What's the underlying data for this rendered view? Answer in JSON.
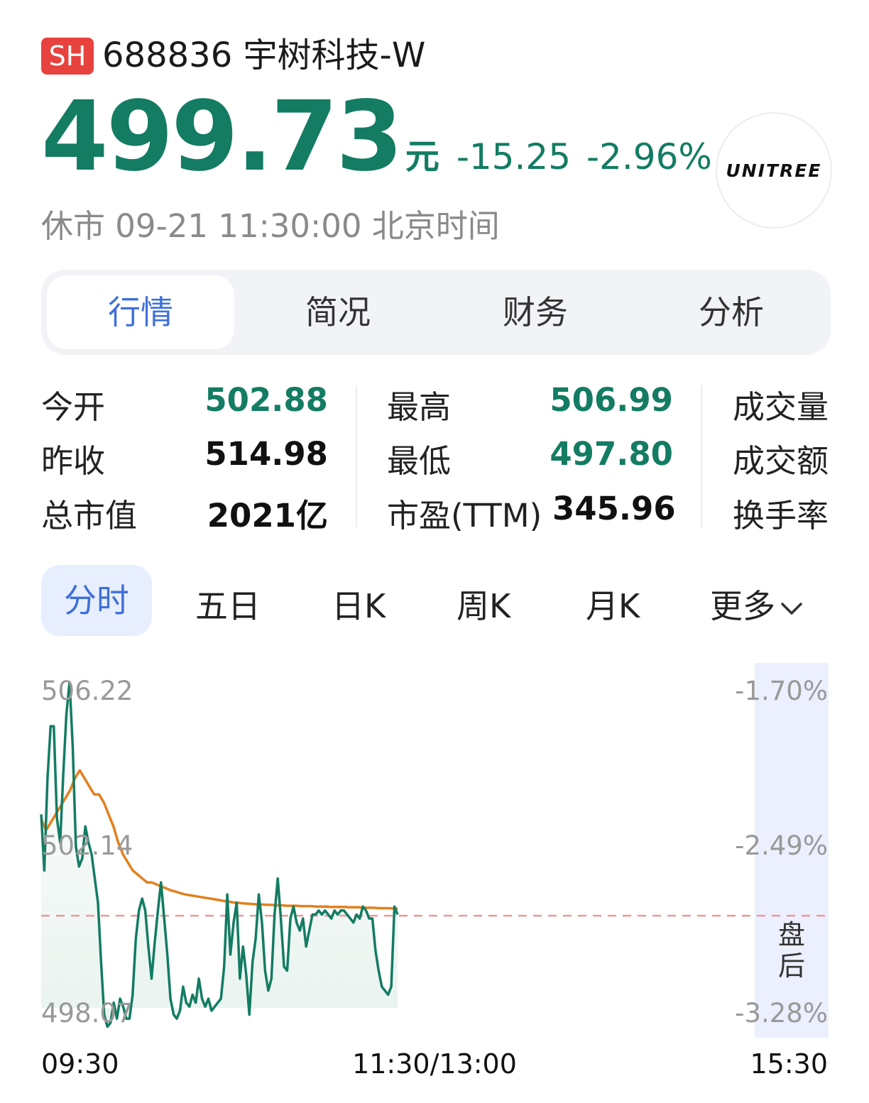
{
  "header": {
    "exchange": "SH",
    "code_name": "688836 宇树科技-W",
    "price": "499.73",
    "price_unit": "元",
    "change": "-15.25",
    "change_pct": "-2.96%",
    "status": "休市 09-21 11:30:00 北京时间",
    "logo_text": "UNITREE"
  },
  "main_tabs": [
    {
      "label": "行情",
      "active": true
    },
    {
      "label": "简况",
      "active": false
    },
    {
      "label": "财务",
      "active": false
    },
    {
      "label": "分析",
      "active": false
    }
  ],
  "quote": {
    "open_label": "今开",
    "open": "502.88",
    "prev_close_label": "昨收",
    "prev_close": "514.98",
    "mkt_cap_label": "总市值",
    "mkt_cap": "2021亿",
    "high_label": "最高",
    "high": "506.99",
    "low_label": "最低",
    "low": "497.80",
    "pe_label": "市盈(TTM)",
    "pe": "345.96",
    "volume_label": "成交量",
    "amount_label": "成交额",
    "turnover_label": "换手率"
  },
  "chart_tabs": [
    {
      "label": "分时",
      "active": true
    },
    {
      "label": "五日",
      "active": false
    },
    {
      "label": "日K",
      "active": false
    },
    {
      "label": "周K",
      "active": false
    },
    {
      "label": "月K",
      "active": false
    },
    {
      "label": "更多",
      "active": false
    }
  ],
  "chart_data": {
    "type": "line",
    "x_time_labels": [
      "09:30",
      "11:30/13:00",
      "15:30"
    ],
    "y_ticks": [
      "506.22",
      "502.14",
      "498.07"
    ],
    "y_pct_ticks": [
      "-1.70%",
      "-2.49%",
      "-3.28%"
    ],
    "ylim": [
      498.07,
      506.22
    ],
    "after_hours_label": "盘后",
    "reference_level": 500.37,
    "colors": {
      "price": "#137c62",
      "avg": "#e2801e",
      "ref": "#e89a9a",
      "fill": "#e9f3ef",
      "after_hours": "#eceffd"
    },
    "series": [
      {
        "values": [
          502.9,
          501.5,
          503.8,
          505.1,
          505.1,
          502.8,
          502.2,
          503.9,
          505.4,
          506.2,
          504.6,
          502.1,
          501.6,
          501.8,
          502.6,
          502.2,
          501.9,
          501.3,
          500.7,
          499.2,
          497.9,
          497.6,
          497.7,
          498.2,
          497.8,
          498.3,
          498.1,
          497.8,
          497.8,
          498.4,
          499.8,
          500.5,
          500.8,
          500.5,
          499.6,
          498.8,
          499.7,
          500.5,
          501.2,
          500.3,
          499.4,
          498.3,
          497.9,
          497.8,
          498.0,
          498.6,
          498.2,
          498.1,
          498.4,
          498.2,
          498.8,
          498.3,
          498.1,
          498.3,
          498.0,
          498.1,
          498.2,
          498.3,
          499.1,
          500.9,
          499.4,
          500.2,
          500.7,
          498.8,
          499.6,
          498.9,
          497.9,
          499.2,
          499.8,
          500.9,
          500.2,
          499.0,
          498.5,
          498.8,
          500.4,
          501.3,
          500.3,
          499.1,
          499.0,
          500.3,
          500.6,
          500.2,
          500.0,
          500.3,
          499.6,
          500.0,
          500.4,
          500.4,
          500.5,
          500.4,
          500.5,
          500.4,
          500.3,
          500.5,
          500.4,
          500.5,
          500.5,
          500.4,
          500.3,
          500.2,
          500.4,
          500.3,
          500.6,
          500.5,
          500.3,
          500.3,
          499.5,
          499.0,
          498.6,
          498.5,
          498.4,
          498.6,
          500.6,
          500.4
        ]
      },
      {
        "values": [
          502.8,
          502.5,
          502.7,
          502.9,
          503.1,
          503.3,
          503.5,
          503.8,
          504.0,
          503.8,
          503.6,
          503.4,
          503.4,
          503.2,
          502.9,
          502.6,
          502.2,
          501.9,
          501.7,
          501.5,
          501.4,
          501.3,
          501.2,
          501.2,
          501.15,
          501.1,
          501.05,
          501.0,
          500.97,
          500.93,
          500.9,
          500.88,
          500.86,
          500.84,
          500.82,
          500.8,
          500.78,
          500.76,
          500.74,
          500.72,
          500.7,
          500.69,
          500.68,
          500.67,
          500.66,
          500.65,
          500.65,
          500.64,
          500.64,
          500.63,
          500.63,
          500.62,
          500.62,
          500.62,
          500.61,
          500.61,
          500.61,
          500.6,
          500.6,
          500.6,
          500.59,
          500.59,
          500.59,
          500.59,
          500.58,
          500.58,
          500.58,
          500.57,
          500.57,
          500.57,
          500.56,
          500.56,
          500.56,
          500.55,
          500.55
        ]
      }
    ]
  }
}
